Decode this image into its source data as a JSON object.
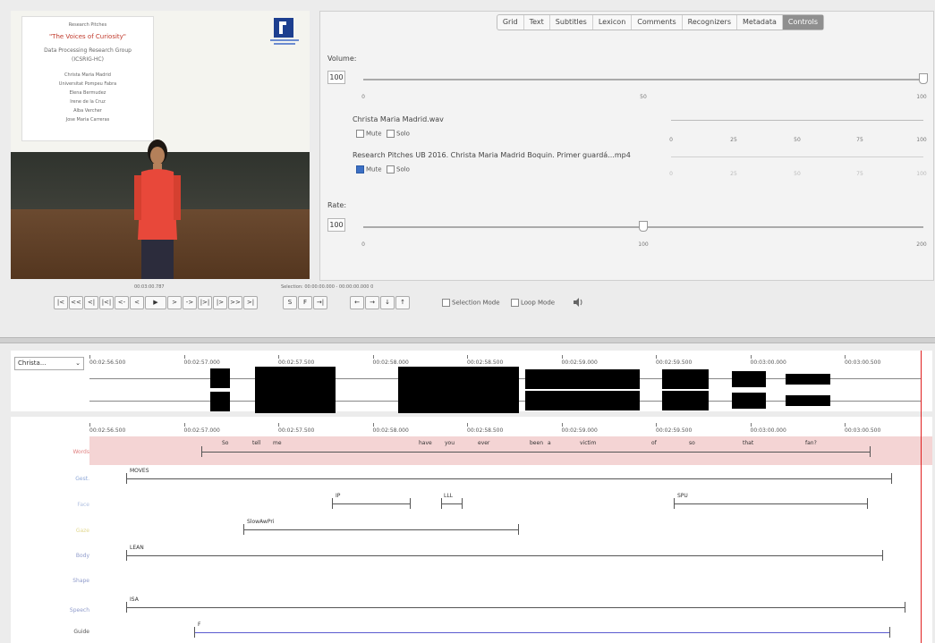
{
  "video": {
    "slide_lines": [
      "Research Pitches",
      "\"The Voices of Curiosity\"",
      "Data Processing Research Group",
      "(ICSRIG-HC)",
      "Christa Maria Madrid",
      "Universitat Pompeu Fabra",
      "Elena Bermudez",
      "Irene de la Cruz",
      "Alba Vercher",
      "Jose Maria Carreras"
    ]
  },
  "tabs": [
    {
      "label": "Grid"
    },
    {
      "label": "Text"
    },
    {
      "label": "Subtitles"
    },
    {
      "label": "Lexicon"
    },
    {
      "label": "Comments"
    },
    {
      "label": "Recognizers"
    },
    {
      "label": "Metadata"
    },
    {
      "label": "Controls"
    }
  ],
  "controls": {
    "volume_label": "Volume:",
    "volume_value": "100",
    "volume_level": 100,
    "volume_ticks": [
      "0",
      "50",
      "100"
    ],
    "track1_name": "Christa Maria Madrid.wav",
    "track1_mute": "Mute",
    "track1_solo": "Solo",
    "track1_ticks": [
      "0",
      "25",
      "50",
      "75",
      "100"
    ],
    "track2_name": "Research Pitches UB 2016. Christa Maria Madrid Boquin. Primer guardá...mp4",
    "track2_mute": "Mute",
    "track2_solo": "Solo",
    "track2_ticks": [
      "0",
      "25",
      "50",
      "75",
      "100"
    ],
    "rate_label": "Rate:",
    "rate_value": "100",
    "rate_level": 100,
    "rate_ticks": [
      "0",
      "100",
      "200"
    ]
  },
  "player": {
    "current_time": "00:03:00.787",
    "selection": "Selection: 00:00:00.000 - 00:00:00.000  0",
    "selection_mode": "Selection Mode",
    "loop_mode": "Loop Mode",
    "buttons": [
      "|<",
      "<<",
      "<|",
      "|<|",
      "<-",
      "<",
      "▶",
      ">",
      "->",
      "|>|",
      "|>",
      ">>",
      ">|"
    ],
    "sel_buttons": [
      "S",
      "F",
      "→|"
    ],
    "nav_buttons": [
      "←",
      "→",
      "↓",
      "↑"
    ]
  },
  "signal": {
    "selector": "Christa...",
    "times": [
      "00:02:56.500",
      "00:02:57.000",
      "00:02:57.500",
      "00:02:58.000",
      "00:02:58.500",
      "00:02:59.000",
      "00:02:59.500",
      "00:03:00.000",
      "00:03:00.500"
    ]
  },
  "timeline": {
    "times": [
      "00:02:56.500",
      "00:02:57.000",
      "00:02:57.500",
      "00:02:58.000",
      "00:02:58.500",
      "00:02:59.000",
      "00:02:59.500",
      "00:03:00.000",
      "00:03:00.500"
    ],
    "words": [
      "So",
      "tell",
      "me",
      "have",
      "you",
      "ever",
      "been",
      "a",
      "victim",
      "of",
      "so",
      "that",
      "fan?"
    ],
    "annotations": [
      "MOVES",
      "IP",
      "LLL",
      "SPU",
      "SlowAwPri",
      "LEAN",
      "ISA",
      "F"
    ],
    "tier_colors": {
      "words": "#e08080",
      "gesture": "#8fa8d8",
      "face": "#b2c2e2",
      "gaze": "#e2d890",
      "body": "#8f9bcb"
    }
  }
}
